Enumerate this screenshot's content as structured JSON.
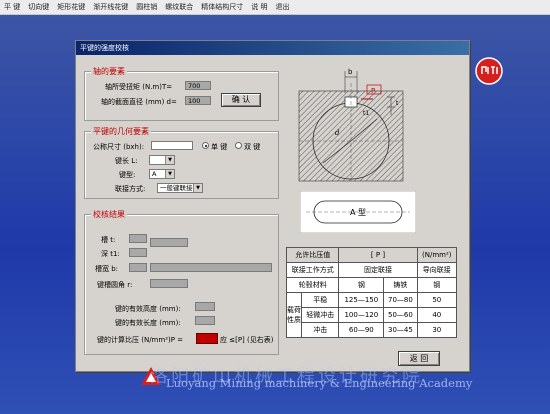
{
  "menu": [
    "平 键",
    "切向键",
    "矩形花键",
    "渐开线花键",
    "圆柱销",
    "螺纹联合",
    "精体结构尺寸",
    "说 明",
    "退出"
  ],
  "dialog": {
    "title": "平键的强度校核"
  },
  "group_shaft": {
    "label": "轴的要素",
    "torque_label": "轴所受扭矩 (N.m)T=",
    "torque_value": "700",
    "diameter_label": "轴的截面直径 (mm) d=",
    "diameter_value": "100",
    "confirm": "确 认"
  },
  "group_key": {
    "label": "平键的几何要素",
    "nominal_label": "公称尺寸 (bxh):",
    "radio_single": "单 键",
    "radio_double": "双 键",
    "length_label": "键长 L:",
    "type_label": "键型:",
    "type_value": "A",
    "joint_label": "联接方式:",
    "joint_value": "一般键联接"
  },
  "group_result": {
    "label": "校核结果",
    "slot_t": "槽 t:",
    "depth_t1": "深 t1:",
    "hub_b": "槽宽 b:",
    "slot_r": "键槽圆角 r:",
    "work_height": "键的有效高度 (mm):",
    "work_length": "键的有效长度 (mm):",
    "calc_pressure": "键的计算比压 (N/mm²)P =",
    "condition": "应 ≤[P] (见右表)"
  },
  "diagram": {
    "label_b": "b",
    "label_P": "P",
    "label_t": "t",
    "label_t1": "t1",
    "label_d": "d",
    "type_label": "A 型"
  },
  "table": {
    "head": [
      "允许比压值",
      "[ P ]",
      "(N/mm²)"
    ],
    "row1": [
      "联接工作方式",
      "固定联接",
      "导向联接"
    ],
    "row2": [
      "轮毂材料",
      "钢",
      "铸铁",
      "钢"
    ],
    "row_group": "载荷性质",
    "rows": [
      [
        "平稳",
        "125—150",
        "70—80",
        "50"
      ],
      [
        "轻微冲击",
        "100—120",
        "50—60",
        "40"
      ],
      [
        "冲击",
        "60—90",
        "30—45",
        "30"
      ]
    ]
  },
  "back": "返 回",
  "footer": {
    "cn": "洛阳矿山机械工程设计研究院",
    "en": "Luoyang Mining machinery & Engineering Academy"
  },
  "colors": {
    "accent_red": "#c00000",
    "dialog_bg": "#d6d3ce"
  }
}
